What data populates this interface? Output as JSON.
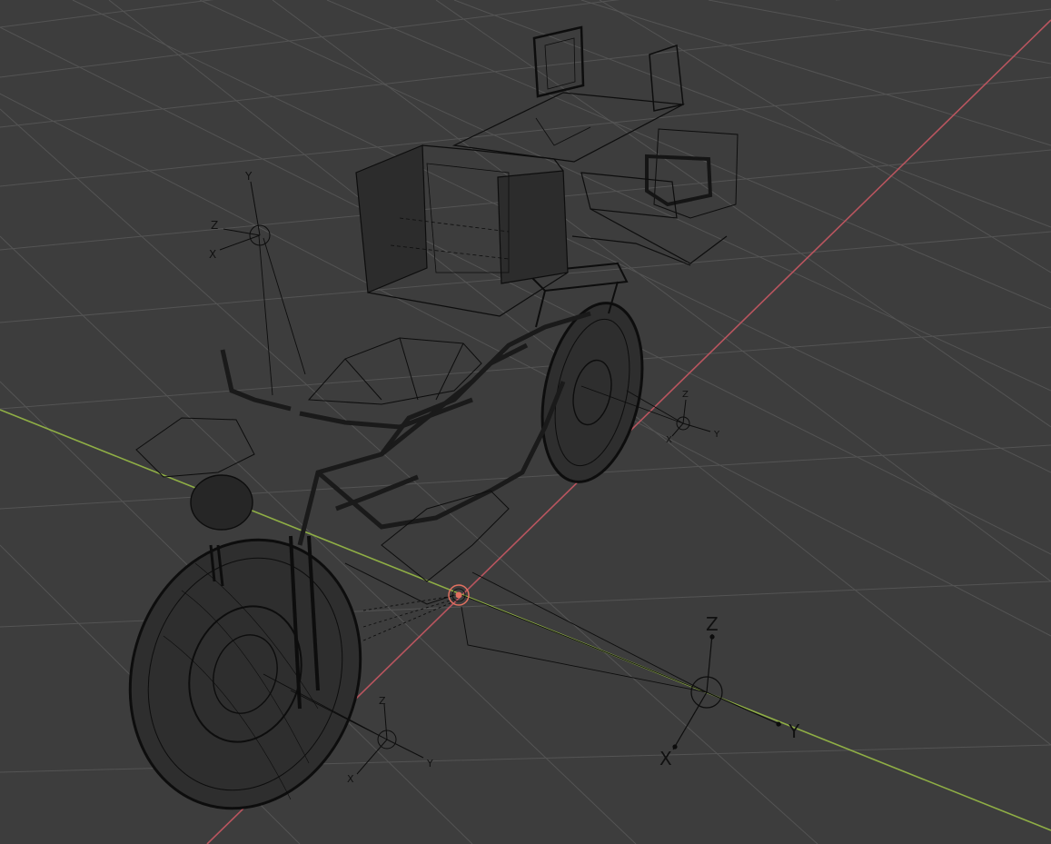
{
  "viewport": {
    "background": "#3d3d3d",
    "grid_color": "#545454",
    "x_axis_color": "#b9555f",
    "y_axis_color": "#8fae45",
    "wire_color": "#0d0d0d",
    "selection_color": "#e07060"
  },
  "empties": [
    {
      "name": "empty-top-left",
      "labels": {
        "x": "X",
        "y": "Y",
        "z": "Z"
      }
    },
    {
      "name": "empty-rear-right",
      "labels": {
        "x": "X",
        "y": "Y",
        "z": "Z"
      }
    },
    {
      "name": "empty-front-bottom",
      "labels": {
        "x": "X",
        "y": "Y",
        "z": "Z"
      }
    },
    {
      "name": "empty-large-right",
      "labels": {
        "x": "X",
        "y": "Y",
        "z": "Z"
      }
    }
  ],
  "object_origin": {
    "icon": "selected-origin-icon"
  }
}
